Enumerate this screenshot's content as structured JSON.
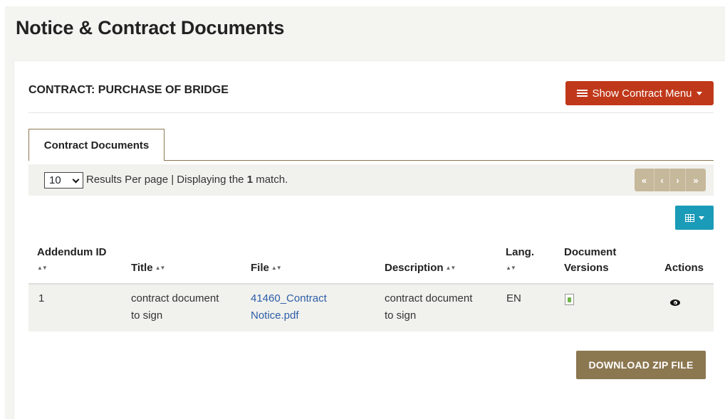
{
  "page": {
    "title": "Notice & Contract Documents"
  },
  "contract": {
    "label": "CONTRACT:",
    "name": "PURCHASE OF BRIDGE"
  },
  "menu_button": {
    "label": "Show Contract Menu",
    "icon": "list-icon"
  },
  "tabs": [
    {
      "label": "Contract Documents",
      "active": true
    }
  ],
  "results": {
    "per_page": "10",
    "text_before": "Results Per page | Displaying the ",
    "count": "1",
    "text_after": " match."
  },
  "pager": {
    "first": "«",
    "prev": "‹",
    "next": "›",
    "last": "»"
  },
  "columns_button": {
    "icon": "grid-icon"
  },
  "table": {
    "headers": {
      "addendum_id": "Addendum ID",
      "title": "Title",
      "file": "File",
      "description": "Description",
      "lang": "Lang.",
      "versions_line1": "Document",
      "versions_line2": "Versions",
      "actions": "Actions"
    },
    "rows": [
      {
        "addendum_id": "1",
        "title_line1": "contract document",
        "title_line2": "to sign",
        "file_line1": "41460_Contract",
        "file_line2": "Notice.pdf",
        "description_line1": "contract document",
        "description_line2": "to sign",
        "lang": "EN",
        "versions_icon": "document-icon",
        "action_icon": "eye-icon"
      }
    ]
  },
  "download_button": {
    "label": "DOWNLOAD ZIP FILE"
  },
  "colors": {
    "brand_brown": "#8b7750",
    "menu_red": "#c0381a",
    "teal": "#1a9bb8",
    "link_blue": "#2c5ea8",
    "pager_tan": "#c6b89a"
  }
}
